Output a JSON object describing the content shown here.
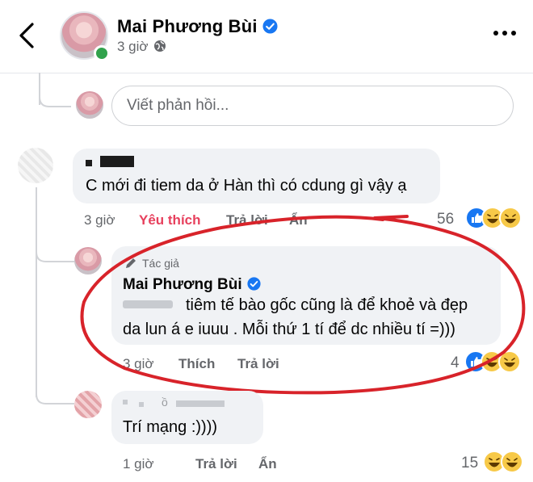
{
  "header": {
    "author_name": "Mai Phương Bùi",
    "time": "3 giờ"
  },
  "reply_box": {
    "placeholder": "Viết phản hồi..."
  },
  "comment1": {
    "text": "C mới đi tiem da ở Hàn thì có cdung gì vậy ạ",
    "time": "3 giờ",
    "like_label": "Yêu thích",
    "reply_label": "Trả lời",
    "hide_label": "Ẩn",
    "reaction_count": "56"
  },
  "reply1": {
    "badge": "Tác giả",
    "author": "Mai Phương Bùi",
    "text_line1": "tiêm tế bào gốc cũng là để khoẻ và đẹp",
    "text_line2": "da lun á e iuuu . Mỗi thứ 1 tí để dc nhiều tí =)))",
    "time": "3 giờ",
    "like_label": "Thích",
    "reply_label": "Trả lời",
    "reaction_count": "4"
  },
  "reply2": {
    "name_fragment": "ồ",
    "text": "Trí mạng :))))",
    "time": "1 giờ",
    "reply_label": "Trả lời",
    "hide_label": "Ẩn",
    "reaction_count": "15"
  },
  "colors": {
    "verified_blue": "#1877f2",
    "like_red": "#e7405d",
    "annotation_red": "#d8232a",
    "bubble_bg": "#f0f2f5",
    "meta_gray": "#65676b"
  },
  "icons": [
    "back-arrow-icon",
    "verified-icon",
    "globe-icon",
    "more-icon",
    "pencil-icon",
    "like-reaction-icon",
    "haha-reaction-icon"
  ]
}
